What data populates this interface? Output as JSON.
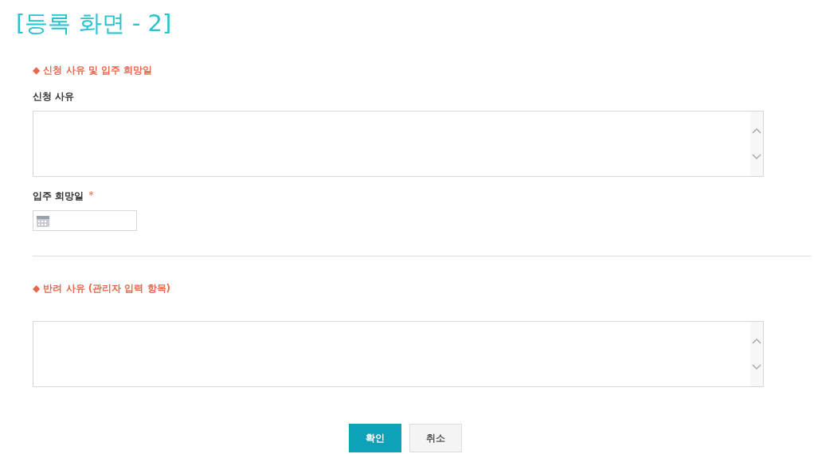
{
  "page_title": "[등록 화면 - 2]",
  "sections": [
    {
      "heading": "◆ 신청 사유 및 입주 희망일",
      "fields": [
        {
          "kind": "textarea",
          "label": "신청 사유"
        },
        {
          "kind": "date",
          "label": "입주 희망일",
          "required_mark": "*"
        }
      ]
    },
    {
      "heading": "◆ 반려 사유 (관리자 입력 항목)",
      "fields": [
        {
          "kind": "textarea"
        }
      ]
    }
  ],
  "buttons": [
    {
      "label": "확인",
      "primary": true
    },
    {
      "label": "취소",
      "primary": false
    }
  ]
}
